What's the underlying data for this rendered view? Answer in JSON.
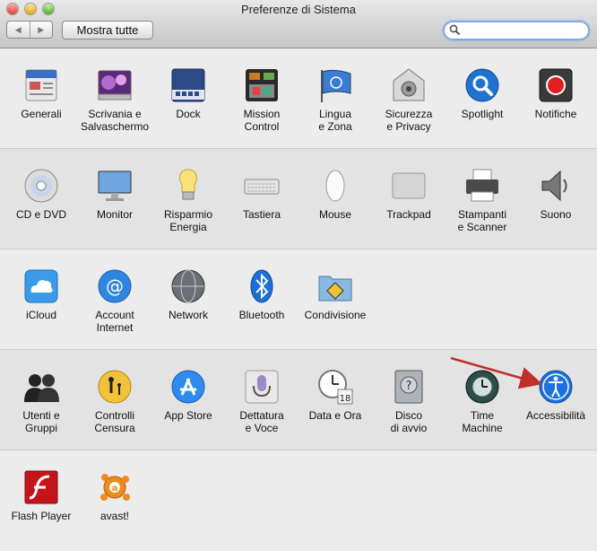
{
  "window": {
    "title": "Preferenze di Sistema"
  },
  "toolbar": {
    "back": "◀",
    "forward": "▶",
    "show_all": "Mostra tutte",
    "search_placeholder": ""
  },
  "sections": [
    {
      "items": [
        {
          "label": "Generali",
          "icon": "general-icon"
        },
        {
          "label": "Scrivania e\nSalvaschermo",
          "icon": "desktop-screensaver-icon"
        },
        {
          "label": "Dock",
          "icon": "dock-icon"
        },
        {
          "label": "Mission\nControl",
          "icon": "mission-control-icon"
        },
        {
          "label": "Lingua\ne Zona",
          "icon": "language-region-icon"
        },
        {
          "label": "Sicurezza\ne Privacy",
          "icon": "security-privacy-icon"
        },
        {
          "label": "Spotlight",
          "icon": "spotlight-icon"
        },
        {
          "label": "Notifiche",
          "icon": "notifications-icon"
        }
      ]
    },
    {
      "items": [
        {
          "label": "CD e DVD",
          "icon": "cd-dvd-icon"
        },
        {
          "label": "Monitor",
          "icon": "monitor-icon"
        },
        {
          "label": "Risparmio\nEnergia",
          "icon": "energy-saver-icon"
        },
        {
          "label": "Tastiera",
          "icon": "keyboard-icon"
        },
        {
          "label": "Mouse",
          "icon": "mouse-icon"
        },
        {
          "label": "Trackpad",
          "icon": "trackpad-icon"
        },
        {
          "label": "Stampanti\ne Scanner",
          "icon": "printer-icon"
        },
        {
          "label": "Suono",
          "icon": "sound-icon"
        }
      ]
    },
    {
      "items": [
        {
          "label": "iCloud",
          "icon": "icloud-icon"
        },
        {
          "label": "Account\nInternet",
          "icon": "internet-accounts-icon"
        },
        {
          "label": "Network",
          "icon": "network-icon"
        },
        {
          "label": "Bluetooth",
          "icon": "bluetooth-icon"
        },
        {
          "label": "Condivisione",
          "icon": "sharing-icon"
        }
      ]
    },
    {
      "items": [
        {
          "label": "Utenti e\nGruppi",
          "icon": "users-groups-icon"
        },
        {
          "label": "Controlli\nCensura",
          "icon": "parental-controls-icon"
        },
        {
          "label": "App Store",
          "icon": "app-store-icon"
        },
        {
          "label": "Dettatura\ne Voce",
          "icon": "dictation-icon"
        },
        {
          "label": "Data e Ora",
          "icon": "date-time-icon"
        },
        {
          "label": "Disco\ndi avvio",
          "icon": "startup-disk-icon"
        },
        {
          "label": "Time\nMachine",
          "icon": "time-machine-icon"
        },
        {
          "label": "Accessibilità",
          "icon": "accessibility-icon"
        }
      ]
    },
    {
      "items": [
        {
          "label": "Flash Player",
          "icon": "flash-player-icon"
        },
        {
          "label": "avast!",
          "icon": "avast-icon"
        }
      ]
    }
  ],
  "calendar_day": "18",
  "annotation": {
    "icon": "red-arrow-icon",
    "color": "#c0302a"
  }
}
